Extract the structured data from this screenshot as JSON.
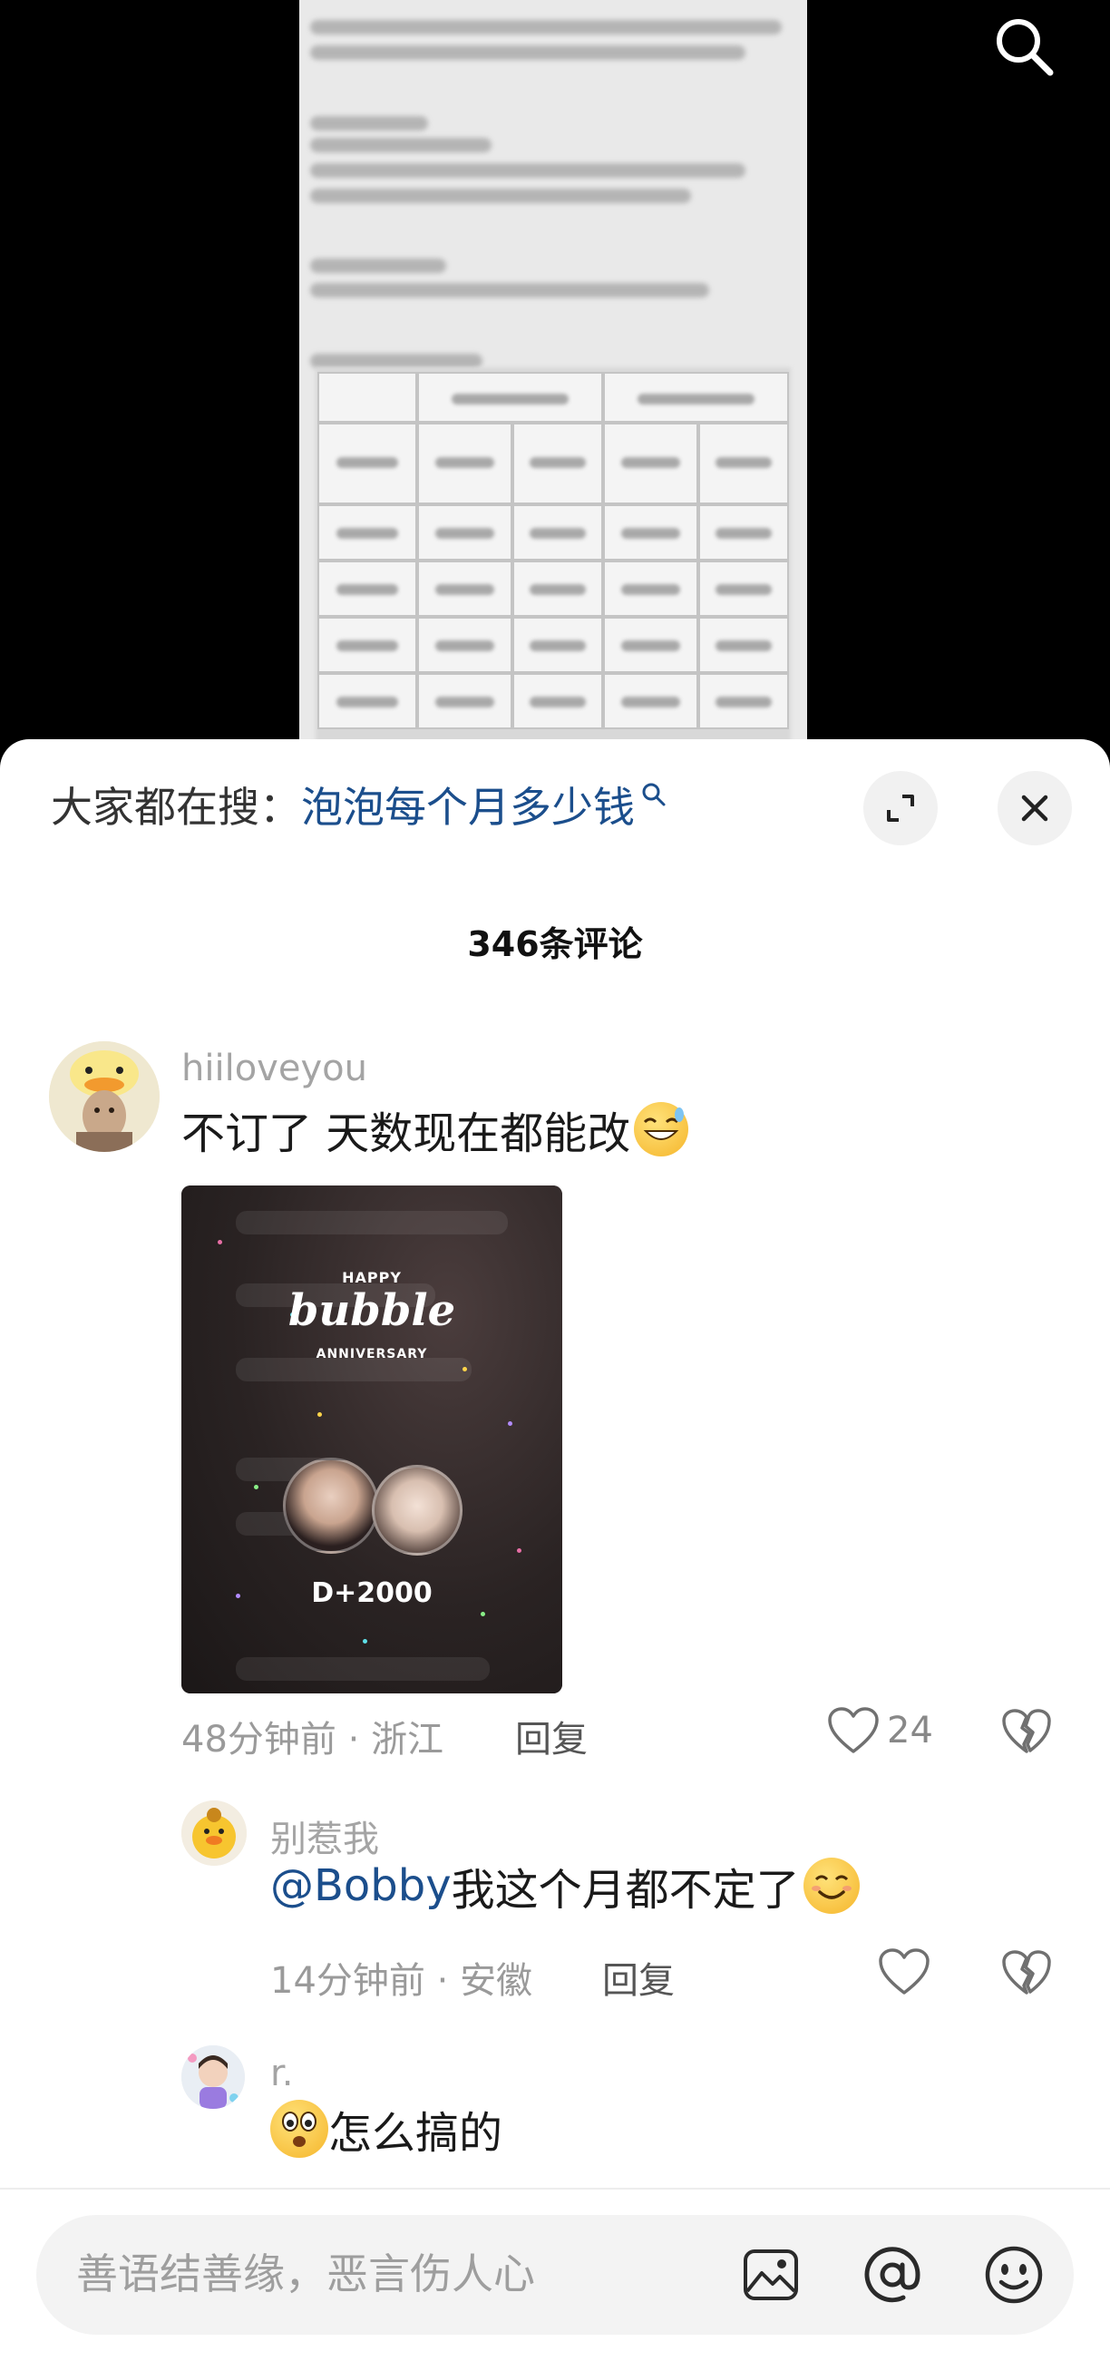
{
  "search_suggest": {
    "prefix": "大家都在搜：",
    "term": "泡泡每个月多少钱"
  },
  "comments_header": {
    "count_label": "346条评论"
  },
  "comments": [
    {
      "username": "hiiloveyou",
      "text": "不订了 天数现在都能改",
      "emoji": "grinning-sweat",
      "image": {
        "header": "HAPPY",
        "logo": "bubble",
        "subtitle": "ANNIVERSARY",
        "counter": "D+2000"
      },
      "time": "48分钟前",
      "location": "浙江",
      "reply_label": "回复",
      "like_count": "24",
      "replies": [
        {
          "username": "别惹我",
          "mention": "@Bobby",
          "text": " 我这个月都不定了",
          "emoji": "smiling",
          "time": "14分钟前",
          "location": "安徽",
          "reply_label": "回复"
        },
        {
          "username": "r.",
          "emoji": "surprised",
          "text": "怎么搞的"
        }
      ]
    }
  ],
  "composer": {
    "placeholder": "善语结善缘，恶言伤人心"
  },
  "colors": {
    "link_blue": "#1b4e8c",
    "meta_gray": "#9a9a9a",
    "sheet_bg": "#ffffff",
    "video_bg": "#000000"
  }
}
